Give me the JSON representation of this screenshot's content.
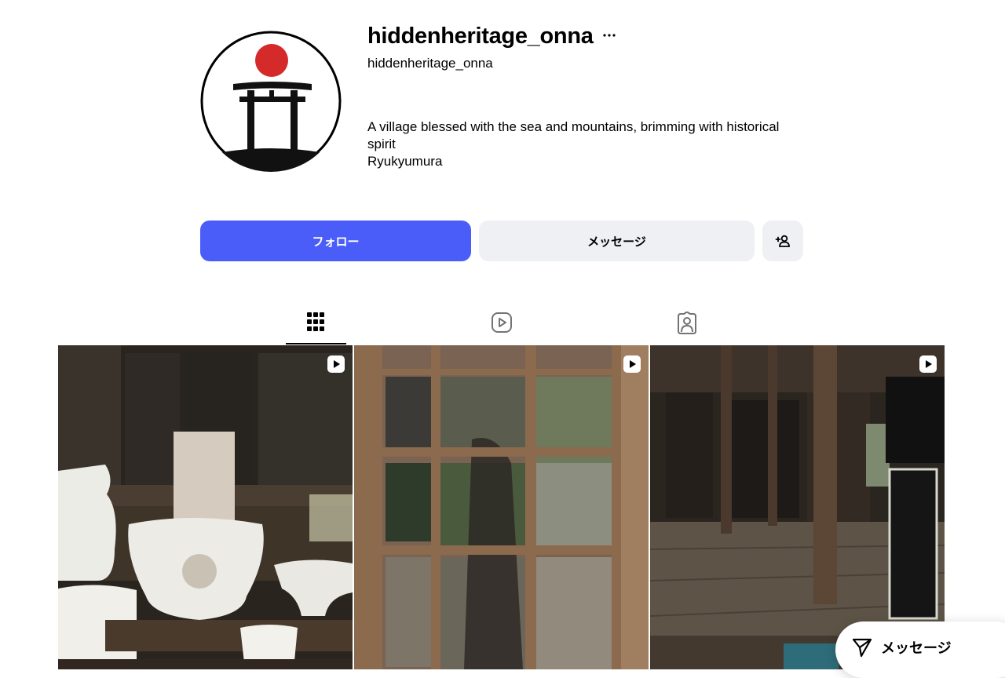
{
  "profile": {
    "username": "hiddenheritage_onna",
    "handle": "hiddenheritage_onna",
    "bio_lines": [
      "A village blessed with the sea and mountains, brimming with historical spirit",
      "Ryukyumura"
    ],
    "avatar_icon": "torii-gate-with-red-sun-icon",
    "more_icon": "ellipsis-icon"
  },
  "actions": {
    "follow_label": "フォロー",
    "message_label": "メッセージ",
    "suggest_icon": "add-person-icon"
  },
  "tabs": [
    {
      "name": "posts",
      "icon": "grid-icon",
      "active": true
    },
    {
      "name": "reels",
      "icon": "reels-icon",
      "active": false
    },
    {
      "name": "tagged",
      "icon": "tagged-user-icon",
      "active": false
    }
  ],
  "posts": [
    {
      "type": "reel",
      "badge_icon": "reel-play-icon",
      "description": "white ceramic vessels on shrine altar"
    },
    {
      "type": "reel",
      "badge_icon": "reel-play-icon",
      "description": "wooden lattice window reflection"
    },
    {
      "type": "reel",
      "badge_icon": "reel-play-icon",
      "description": "old wooden house interior with sign"
    }
  ],
  "floating_message": {
    "label": "メッセージ",
    "icon": "send-icon"
  },
  "colors": {
    "primary": "#4a5df9",
    "secondary_button": "#eff0f3",
    "avatar_sun": "#d42a2a"
  }
}
